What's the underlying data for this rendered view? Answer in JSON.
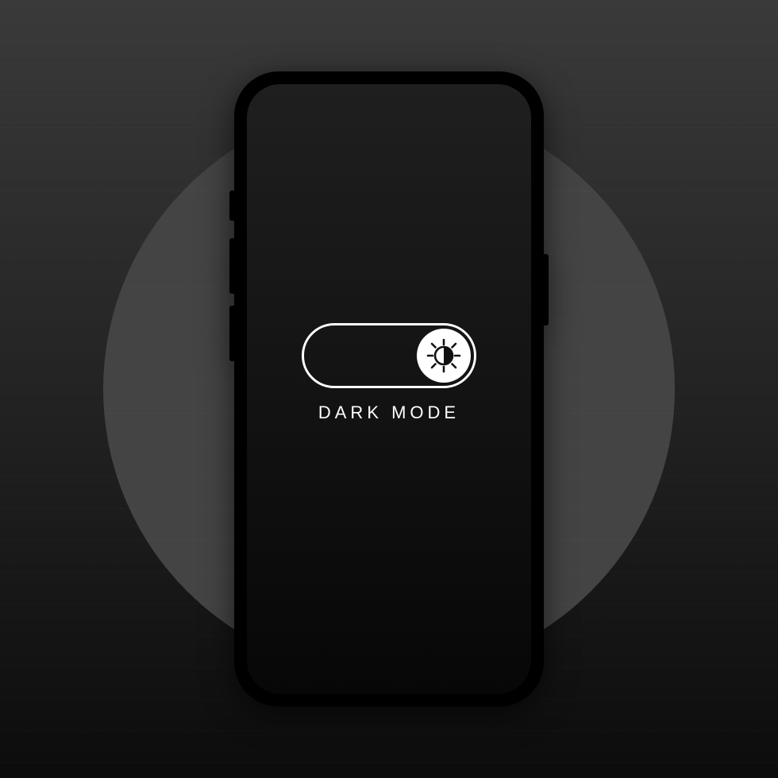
{
  "toggle": {
    "label": "DARK MODE",
    "state": "on",
    "icon_name": "brightness-contrast-icon"
  }
}
